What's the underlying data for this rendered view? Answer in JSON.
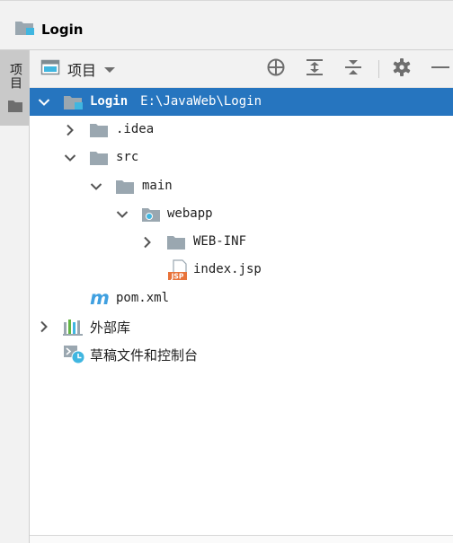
{
  "window": {
    "title": "Login"
  },
  "breadcrumb": {
    "project": "Login",
    "icon": "project-folder-icon"
  },
  "side_stripe": {
    "label": "项目",
    "icon": "folder-icon"
  },
  "tool_window": {
    "view_label": "项目",
    "view_icon": "project-view-icon",
    "actions": [
      "locate-icon",
      "expand-all-icon",
      "collapse-all-icon",
      "gear-icon",
      "minimize-icon"
    ]
  },
  "tree": {
    "root": {
      "label": "Login",
      "path": "E:\\JavaWeb\\Login",
      "expanded": true,
      "selected": true
    },
    "nodes": [
      {
        "label": ".idea",
        "expanded": false,
        "icon": "folder-icon"
      },
      {
        "label": "src",
        "expanded": true,
        "icon": "folder-icon"
      },
      {
        "label": "main",
        "expanded": true,
        "icon": "folder-icon"
      },
      {
        "label": "webapp",
        "expanded": true,
        "icon": "web-folder-icon"
      },
      {
        "label": "WEB-INF",
        "expanded": false,
        "icon": "folder-icon"
      },
      {
        "label": "index.jsp",
        "icon": "jsp-file-icon",
        "icon_text": "JSP"
      },
      {
        "label": "pom.xml",
        "icon": "maven-icon",
        "icon_text": "m"
      },
      {
        "label": "外部库",
        "expanded": false,
        "icon": "library-icon"
      },
      {
        "label": "草稿文件和控制台",
        "icon": "scratches-icon"
      }
    ]
  },
  "colors": {
    "selection": "#2675bf",
    "folder": "#9aa7b0",
    "accent_blue": "#40b6e0",
    "jsp_orange": "#e8733a"
  }
}
